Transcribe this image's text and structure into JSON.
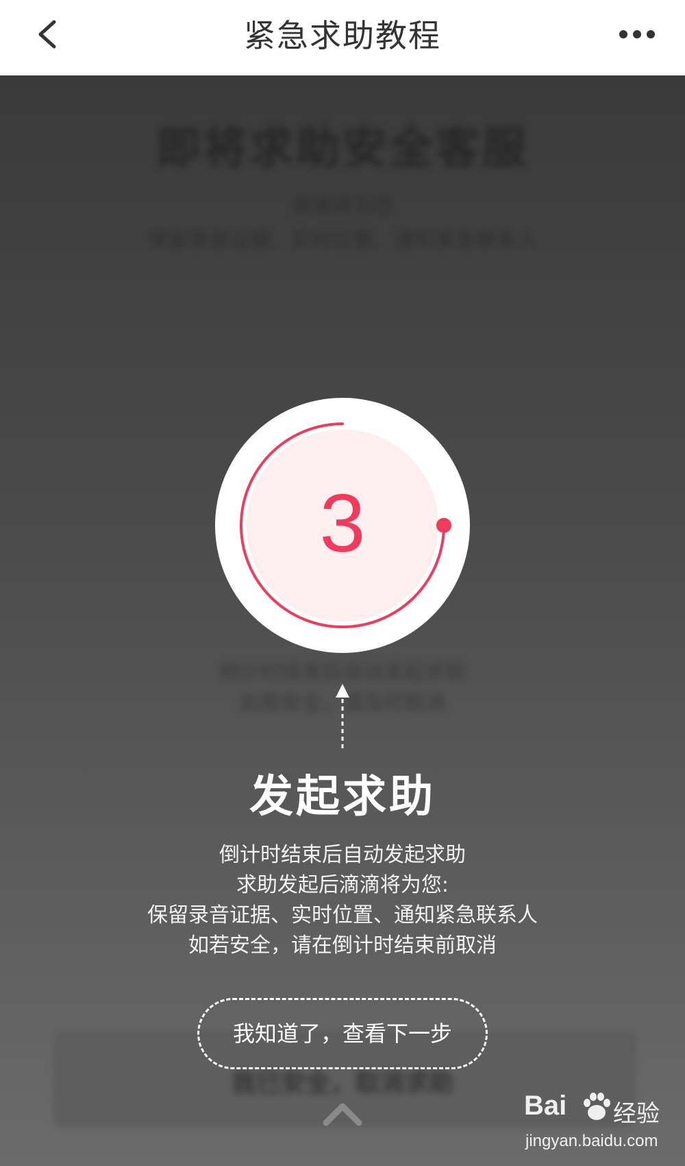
{
  "header": {
    "title": "紧急求助教程",
    "back_icon": "chevron-left-icon",
    "more_icon": "more-horizontal-icon"
  },
  "background": {
    "title": "即将求助安全客服",
    "subtitle_line1": "滴滴将为您",
    "subtitle_line2": "保留录音证据、实时位置、通知紧急联系人",
    "hint_line1": "倒计时结束后自动发起求助",
    "hint_line2": "如若安全，请及时取消",
    "cancel_button": "我已安全，取消求助"
  },
  "countdown": {
    "value": "3",
    "progress": 0.75,
    "accent_color": "#f23b5c",
    "inner_fill": "#fdeef0"
  },
  "tutorial": {
    "title": "发起求助",
    "description": [
      "倒计时结束后自动发起求助",
      "求助发起后滴滴将为您:",
      "保留录音证据、实时位置、通知紧急联系人",
      "如若安全，请在倒计时结束前取消"
    ],
    "next_button": "我知道了，查看下一步",
    "up_icon": "chevron-up-icon"
  },
  "watermark": {
    "brand": "Bai",
    "brand_suffix": "经验",
    "url": "jingyan.baidu.com"
  }
}
